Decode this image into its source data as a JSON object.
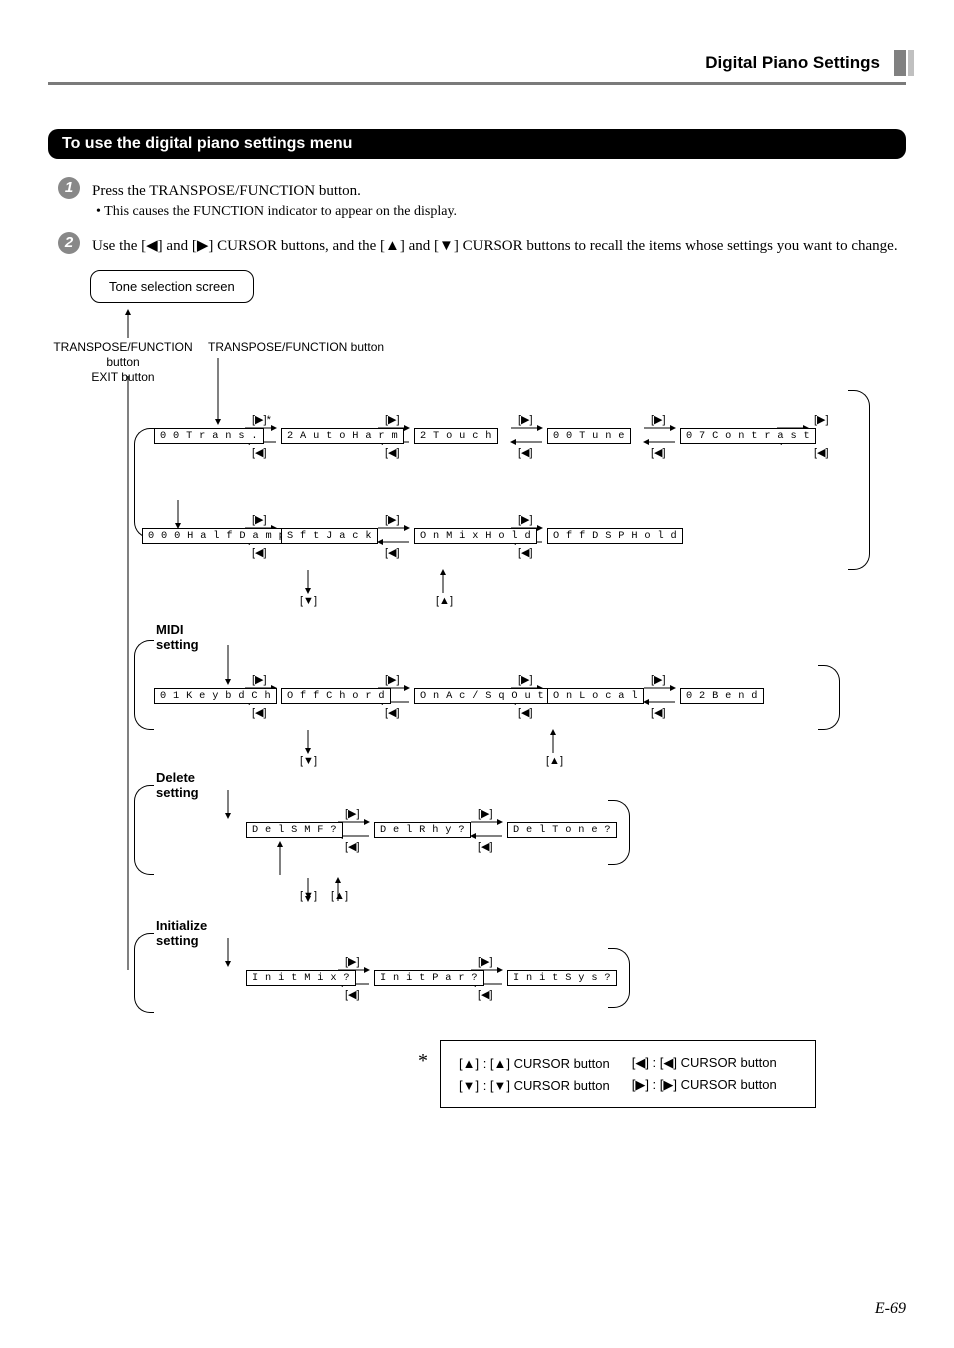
{
  "header": {
    "section": "Digital Piano Settings"
  },
  "bar": {
    "title": "To use the digital piano settings menu"
  },
  "steps": {
    "s1": {
      "num": "1",
      "line1": "Press the TRANSPOSE/FUNCTION button.",
      "bullet": "• This causes the FUNCTION indicator to appear on the display."
    },
    "s2": {
      "num": "2",
      "line1": "Use the [◀] and [▶] CURSOR buttons, and the [▲] and [▼] CURSOR buttons to recall the items whose settings you want to change."
    }
  },
  "diagram": {
    "tone_box": "Tone selection screen",
    "left_label": "TRANSPOSE/FUNCTION\nbutton\nEXIT button",
    "top_label": "TRANSPOSE/FUNCTION button",
    "row1": {
      "c1": "0 0 T r a n s .",
      "c2": "2 A u t o H a r m",
      "c3": "2 T o u c h",
      "c4": "0 0 T u n e",
      "c5": "0 7 C o n t r a s t"
    },
    "row1b": {
      "c1": "0 0 0 H a l f D a m p",
      "c2": "S f t J a c k",
      "c3": "O n   M i x H o l d",
      "c4": "O f f D S P   H o l d"
    },
    "midi_label": "MIDI\nsetting",
    "row2": {
      "c1": "0 1 K e y b d   C h",
      "c2": "O f f C h o r d",
      "c3": "O n   A c / S q O u t",
      "c4": "O n   L o c a l",
      "c5": "0 2 B e n d"
    },
    "del_label": "Delete\nsetting",
    "row3": {
      "c1": "D e l S M F ?",
      "c2": "D e l R h y ?",
      "c3": "D e l T o n e ?"
    },
    "init_label": "Initialize\nsetting",
    "row4": {
      "c1": "I n i t M i x ?",
      "c2": "I n i t P a r ?",
      "c3": "I n i t S y s ?"
    },
    "dir": {
      "right": "[▶]",
      "right_star": "[▶]*",
      "left": "[◀]",
      "up": "[▲]",
      "down": "[▼]"
    }
  },
  "legend": {
    "star": "*",
    "r1c1": "[▲] :  [▲] CURSOR button",
    "r1c2": "[◀] :  [◀] CURSOR button",
    "r2c1": "[▼] :  [▼] CURSOR button",
    "r2c2": "[▶] :  [▶] CURSOR button"
  },
  "page_num": "E-69"
}
